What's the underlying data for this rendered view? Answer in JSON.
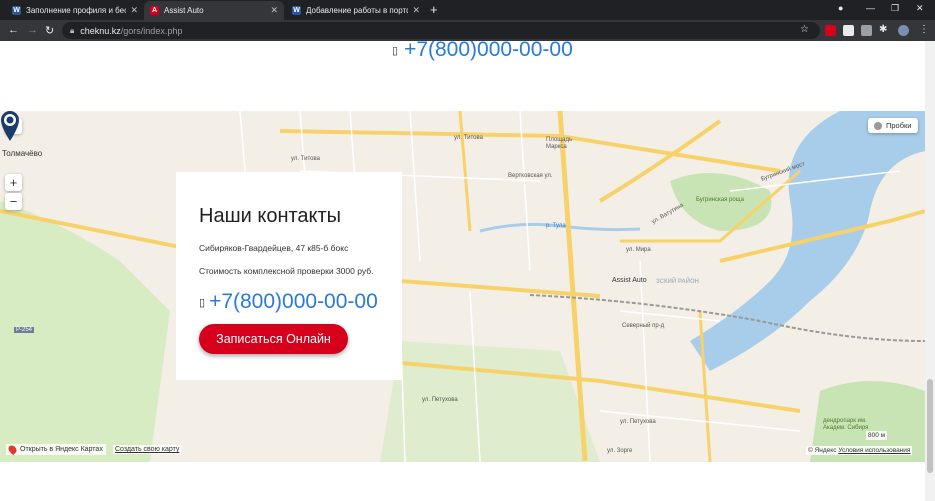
{
  "browser": {
    "tabs": [
      {
        "icon": "W",
        "title": "Заполнение профиля и беспла",
        "active": false,
        "color": "#2b579a"
      },
      {
        "icon": "А",
        "title": "Assist Auto",
        "active": true,
        "color": "#d6001c"
      },
      {
        "icon": "W",
        "title": "Добавление работы в портфо",
        "active": false,
        "color": "#2b579a"
      }
    ],
    "url_host": "cheknu.kz",
    "url_path": "/gors/index.php"
  },
  "page": {
    "top_phone": "+7(800)000-00-00"
  },
  "contacts": {
    "title": "Наши контакты",
    "address": "Сибиряков-Гвардейцев, 47 к85-б бокс",
    "price": "Стоимость комплексной проверки 3000 руб.",
    "phone": "+7(800)000-00-00",
    "button": "Записаться Онлайн",
    "accent": "#d6001c",
    "link_color": "#2a7ad8"
  },
  "map": {
    "traffic_label": "Пробки",
    "zoom_in": "+",
    "zoom_out": "−",
    "marker_label": "Assist Auto",
    "open_in_yandex": "Открыть в Яндекс Картах",
    "create_map": "Создать свою карту",
    "scale": "800 м",
    "copyright": "© Яндекс",
    "terms": "Условия использования",
    "labels": {
      "tolmachevo": "Толмачёво",
      "bugrinskaya": "Бугринская роща",
      "ploshchad_marksa": "Площадь Маркса",
      "ul_titova": "ул. Титова",
      "ul_titova2": "ул. Титова",
      "ul_vatutina": "ул. Ватутина",
      "ul_mira": "ул. Мира",
      "ul_petukhova": "ул. Петухова",
      "ul_petukhova2": "ул. Петухова",
      "ul_zorge": "ул. Зорге",
      "severny": "Северный пр-д",
      "bugrinsky_most": "Бугринский мост",
      "vertkovskaya": "Вертковская ул.",
      "r254": "Р-254",
      "ul_tula": "р. Тула",
      "kirovsky": "ЗСКИЙ РАЙОН",
      "dendropark": "дендропарк им. Академ. Сибиря"
    }
  }
}
